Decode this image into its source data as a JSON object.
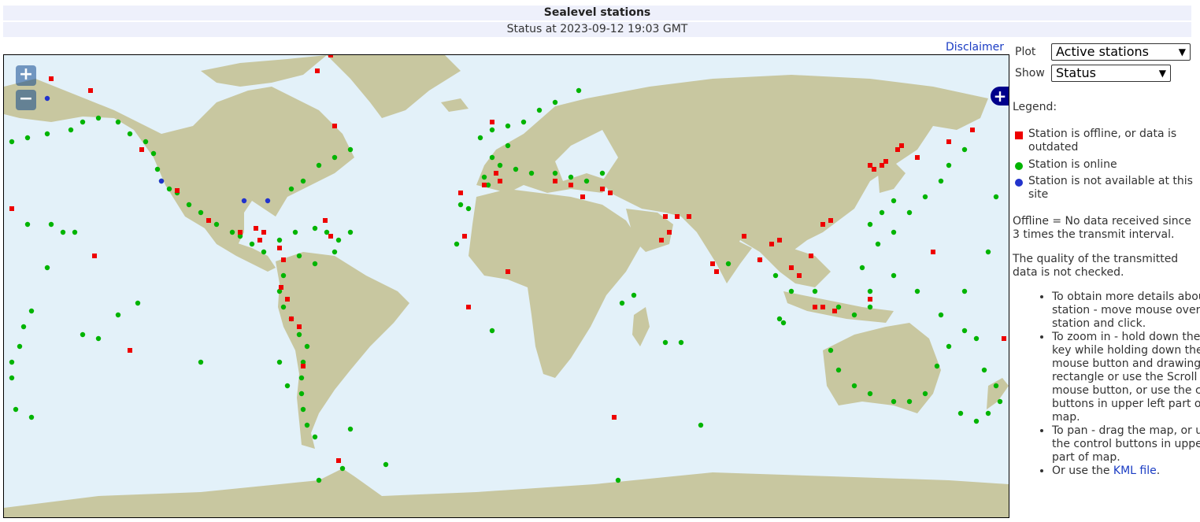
{
  "header": {
    "title": "Sealevel stations",
    "status": "Status at 2023-09-12 19:03 GMT"
  },
  "links": {
    "disclaimer": "Disclaimer"
  },
  "controls": {
    "plot_label": "Plot",
    "plot_value": "Active stations",
    "show_label": "Show",
    "show_value": "Status"
  },
  "map": {
    "zoom_in": "+",
    "zoom_out": "−",
    "layer_switcher": "+",
    "colors": {
      "ocean": "#e3f1f9",
      "land": "#c8c7a0",
      "offline": "#ee0000",
      "online": "#00b400",
      "not_available": "#2233cc"
    },
    "icons": [
      "zoom-in-icon",
      "zoom-out-icon",
      "layer-switcher-icon"
    ]
  },
  "legend": {
    "title": "Legend:",
    "items": [
      {
        "label": "Station is offline, or data is outdated",
        "color": "#ee0000",
        "shape": "square"
      },
      {
        "label": "Station is online",
        "color": "#00b400",
        "shape": "circle"
      },
      {
        "label": "Station is not available at this site",
        "color": "#2233cc",
        "shape": "circle"
      }
    ]
  },
  "notes": {
    "offline": "Offline = No data received since 3 times the transmit interval.",
    "quality": "The quality of the transmitted data is not checked."
  },
  "help": {
    "details": "To obtain more details about a station - move mouse over station and click.",
    "zoom": "To zoom in - hold down the Shift-key while holding down the mouse button and drawing a rectangle or use the Scroll mouse button, or use the control buttons in upper left part of map.",
    "pan": "To pan - drag the map, or use the control buttons in upper left part of map.",
    "kml_prefix": "Or use the ",
    "kml_link": "KML file",
    "kml_suffix": "."
  }
}
